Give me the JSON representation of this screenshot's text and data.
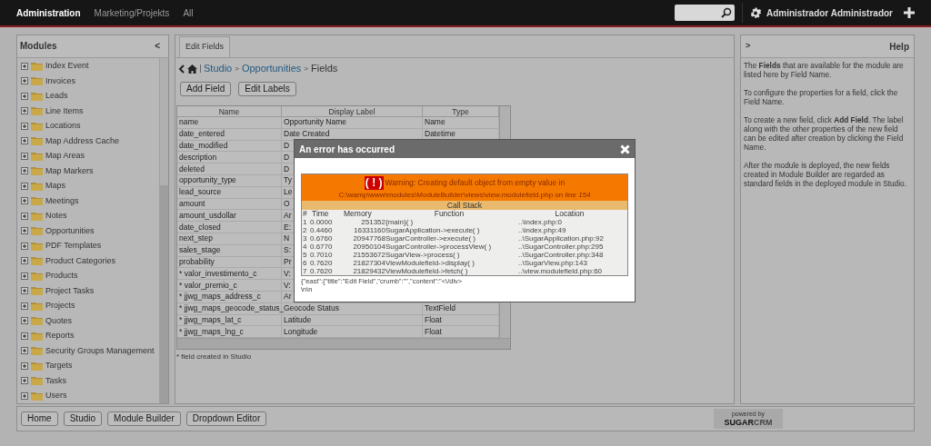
{
  "top_nav": {
    "tabs": [
      {
        "label": "Administration",
        "selected": true
      },
      {
        "label": "Marketing/Projekts",
        "selected": false
      },
      {
        "label": "All",
        "selected": false
      }
    ],
    "user": "Administrador Administrador"
  },
  "modules_panel": {
    "title": "Modules",
    "collapse": "<",
    "items": [
      "Index Event",
      "Invoices",
      "Leads",
      "Line Items",
      "Locations",
      "Map Address Cache",
      "Map Areas",
      "Map Markers",
      "Maps",
      "Meetings",
      "Notes",
      "Opportunities",
      "PDF Templates",
      "Product Categories",
      "Products",
      "Project Tasks",
      "Projects",
      "Quotes",
      "Reports",
      "Security Groups Management",
      "Targets",
      "Tasks",
      "Users"
    ]
  },
  "editor": {
    "tab": "Edit Fields",
    "breadcrumb": {
      "items": [
        "Studio",
        "Opportunities",
        "Fields"
      ],
      "separator": ">"
    },
    "buttons": [
      "Add Field",
      "Edit Labels"
    ],
    "table": {
      "columns": [
        "Name",
        "Display Label",
        "Type"
      ],
      "rows": [
        [
          "name",
          "Opportunity Name",
          "Name"
        ],
        [
          "date_entered",
          "Date Created",
          "Datetime"
        ],
        [
          "date_modified",
          "D",
          ""
        ],
        [
          "description",
          "D",
          ""
        ],
        [
          "deleted",
          "D",
          ""
        ],
        [
          "opportunity_type",
          "Ty",
          ""
        ],
        [
          "lead_source",
          "Le",
          ""
        ],
        [
          "amount",
          "O",
          ""
        ],
        [
          "amount_usdollar",
          "Ar",
          ""
        ],
        [
          "date_closed",
          "E:",
          ""
        ],
        [
          "next_step",
          "N",
          ""
        ],
        [
          "sales_stage",
          "S:",
          ""
        ],
        [
          "probability",
          "Pr",
          ""
        ],
        [
          "* valor_investimento_c",
          "V:",
          ""
        ],
        [
          "* valor_premio_c",
          "V:",
          ""
        ],
        [
          "* jjwg_maps_address_c",
          "Ar",
          ""
        ],
        [
          "* jjwg_maps_geocode_status_",
          "Geocode Status",
          "TextField"
        ],
        [
          "* jjwg_maps_lat_c",
          "Latitude",
          "Float"
        ],
        [
          "* jjwg_maps_lng_c",
          "Longitude",
          "Float"
        ]
      ]
    },
    "footnote": "* field created in Studio"
  },
  "help_panel": {
    "expand": ">",
    "title": "Help",
    "paragraphs": [
      "The **Fields** that are available for the module are listed here by Field Name.",
      "To configure the properties for a field, click the Field Name.",
      "To create a new field, click **Add Field**. The label along with the other properties of the new field can be edited after creation by clicking the Field Name.",
      "After the module is deployed, the new fields created in Module Builder are regarded as standard fields in the deployed module in Studio."
    ]
  },
  "footer": {
    "buttons": [
      "Home",
      "Studio",
      "Module Builder",
      "Dropdown Editor"
    ],
    "logo": {
      "caption": "powered by",
      "brand": "SUGAR",
      "suffix": "CRM"
    }
  },
  "dialog": {
    "title": "An error has occurred",
    "warning_mark": "( ! )",
    "warning": "Warning: Creating default object from empty value in",
    "path": "C:\\wamp\\www\\modules\\ModuleBuilder\\views\\view.modulefield.php on line *154*",
    "stack_title": "Call Stack",
    "columns": [
      "#",
      "Time",
      "Memory",
      "Function",
      "Location"
    ],
    "rows": [
      [
        "1",
        "0.0000",
        "251352",
        "{main}( )",
        "..\\index.php:0"
      ],
      [
        "2",
        "0.4460",
        "16331160",
        "SugarApplication->execute( )",
        "..\\index.php:49"
      ],
      [
        "3",
        "0.6760",
        "20947768",
        "SugarController->execute( )",
        "..\\SugarApplication.php:92"
      ],
      [
        "4",
        "0.6770",
        "20950104",
        "SugarController->processView( )",
        "..\\SugarController.php:295"
      ],
      [
        "5",
        "0.7010",
        "21553672",
        "SugarView->process( )",
        "..\\SugarController.php:348"
      ],
      [
        "6",
        "0.7620",
        "21827304",
        "ViewModulefield->display( )",
        "..\\SugarView.php:143"
      ],
      [
        "7",
        "0.7620",
        "21829432",
        "ViewModulefield->fetch( )",
        "..\\view.modulefield.php:60"
      ]
    ],
    "response": "{\"east\":{\"title\":\"Edit Field\",\"crumb\":\"\",\"content\":\"<\\/div>\\n\\n"
  }
}
